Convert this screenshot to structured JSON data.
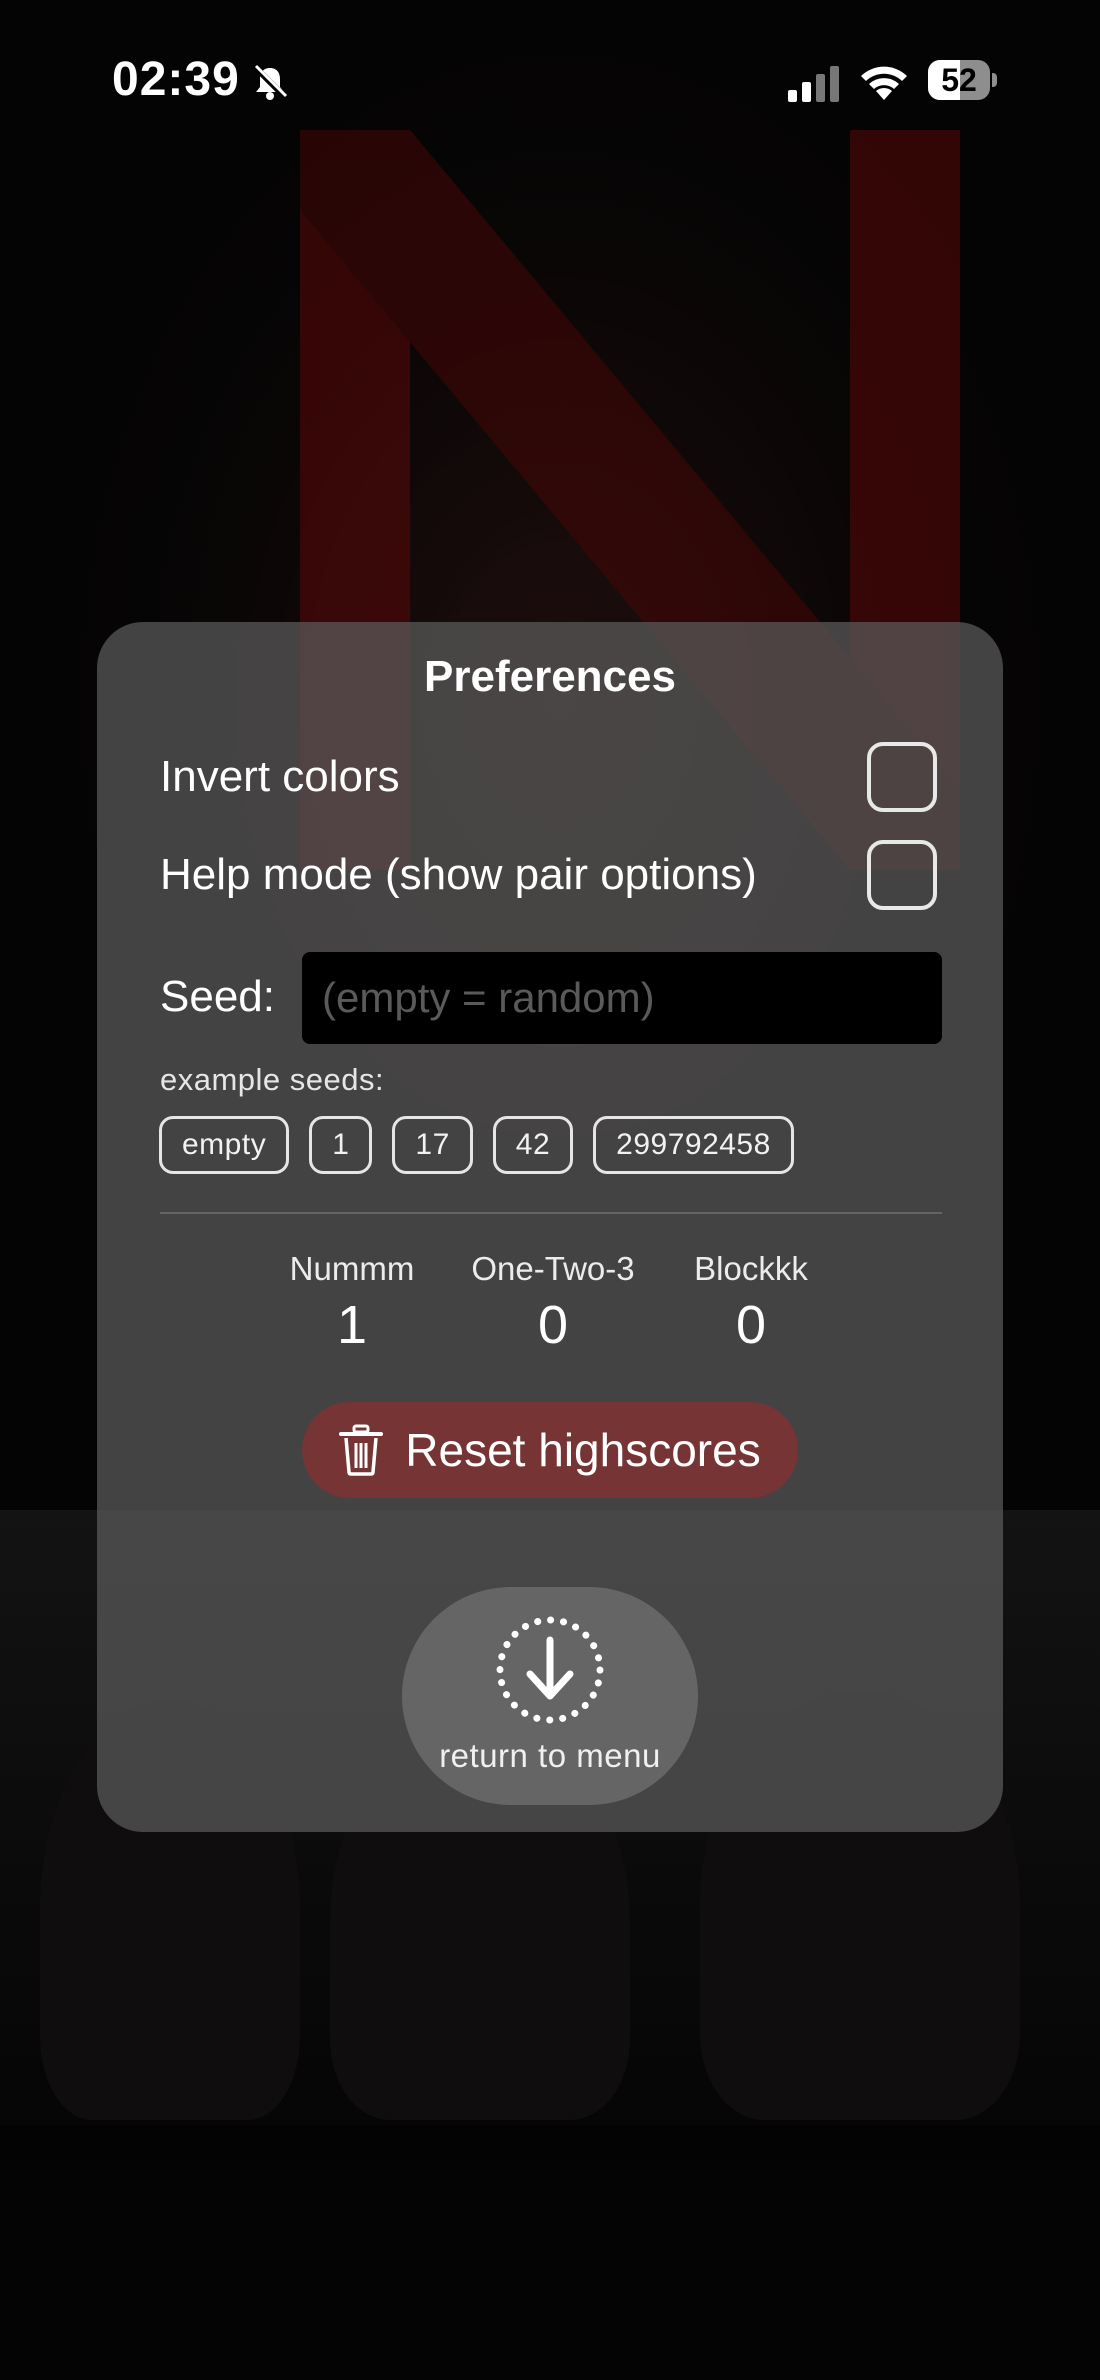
{
  "status_bar": {
    "time": "02:39",
    "battery_level": "52",
    "battery_fraction": 0.52,
    "icons": [
      "bell-slash-icon",
      "signal-icon",
      "wifi-icon",
      "battery-icon"
    ]
  },
  "background": {
    "letter": "N",
    "accent_color": "#8b0d0d"
  },
  "preferences": {
    "title": "Preferences",
    "invert_colors": {
      "label": "Invert colors",
      "checked": false
    },
    "help_mode": {
      "label": "Help mode (show pair options)",
      "checked": false
    },
    "seed": {
      "label": "Seed:",
      "value": "",
      "placeholder": "(empty = random)"
    },
    "example_seeds_label": "example seeds:",
    "example_seeds": [
      "empty",
      "1",
      "17",
      "42",
      "299792458"
    ],
    "highscores": [
      {
        "name": "Nummm",
        "score": "1"
      },
      {
        "name": "One-Two-3",
        "score": "0"
      },
      {
        "name": "Blockkk",
        "score": "0"
      }
    ],
    "reset_label": "Reset highscores",
    "reset_icon": "trash-icon",
    "return_label": "return to menu",
    "return_icon": "arrow-down-circle-dotted-icon"
  }
}
